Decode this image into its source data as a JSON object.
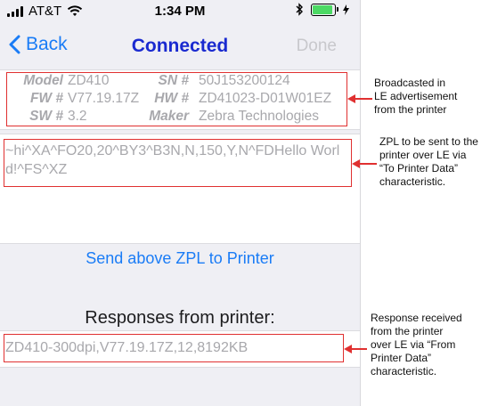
{
  "status_bar": {
    "carrier": "AT&T",
    "time": "1:34 PM"
  },
  "nav": {
    "back_label": "Back",
    "title": "Connected",
    "done_label": "Done"
  },
  "printer_info": {
    "model_label": "Model",
    "model_value": "ZD410",
    "sn_label": "SN #",
    "sn_value": "50J153200124",
    "fw_label": "FW #",
    "fw_value": "V77.19.17Z",
    "hw_label": "HW #",
    "hw_value": "ZD41023-D01W01EZ",
    "sw_label": "SW #",
    "sw_value": "3.2",
    "maker_label": "Maker",
    "maker_value": "Zebra Technologies"
  },
  "zpl": {
    "text": "~hi^XA^FO20,20^BY3^B3N,N,150,Y,N^FDHello World!^FS^XZ"
  },
  "send_button": {
    "label": "Send above ZPL to Printer"
  },
  "responses": {
    "title": "Responses from printer:",
    "text": "ZD410-300dpi,V77.19.17Z,12,8192KB"
  },
  "annotations": {
    "broadcast": [
      "Broadcasted in",
      "LE advertisement",
      "from the printer"
    ],
    "zpl": [
      "ZPL to be sent to the",
      "printer over LE via",
      "“To Printer Data”",
      "characteristic."
    ],
    "response": [
      "Response received",
      "from the printer",
      "over LE via “From",
      "Printer Data”",
      "characteristic."
    ]
  },
  "colors": {
    "accent": "#1a7cf6",
    "title": "#1a2ad0",
    "highlight": "#e03030",
    "battery": "#4cd964"
  }
}
